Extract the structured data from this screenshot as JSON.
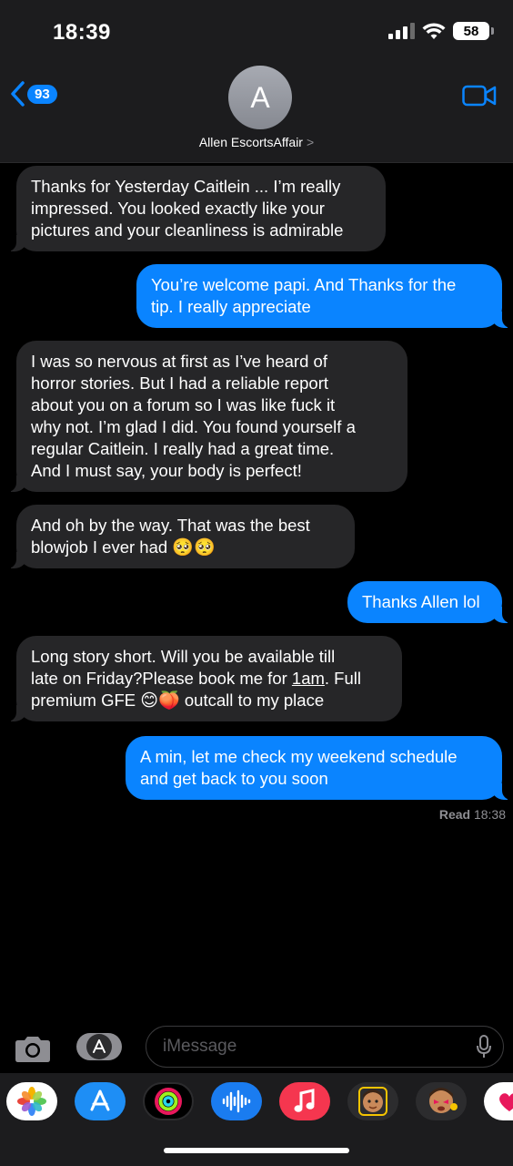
{
  "status_bar": {
    "time": "18:39",
    "battery": "58"
  },
  "nav": {
    "back_count": "93",
    "avatar_initial": "A",
    "contact_name": "Allen EscortsAffair",
    "contact_chevron": ">"
  },
  "messages": [
    {
      "direction": "incoming",
      "text": "Thanks for Yesterday Caitlein ... I’m really\nimpressed. You looked exactly like your\npictures and your cleanliness is admirable"
    },
    {
      "direction": "outgoing",
      "text": "You’re welcome papi. And Thanks for the\ntip. I really appreciate"
    },
    {
      "direction": "incoming",
      "text": "I was so nervous at first as I’ve heard of\nhorror stories. But I had a reliable report\nabout you on a forum so I was like fuck it\nwhy not. I’m glad I did.  You found yourself a\nregular Caitlein. I really had a great time.\nAnd I must say, your body is perfect!"
    },
    {
      "direction": "incoming",
      "text_a": "And oh by the way. That was the best\nblowjob I ever had ",
      "emoji": "🥺🥺"
    },
    {
      "direction": "outgoing",
      "text": "Thanks Allen lol"
    },
    {
      "direction": "incoming",
      "text_a": "Long story short. Will you be available till\nlate on Friday?Please book me for ",
      "link": "1am",
      "text_b": ". Full\npremium GFE ",
      "emoji": "😊🍑",
      "text_c": " outcall to my place"
    },
    {
      "direction": "outgoing",
      "text": "A min, let me check my weekend schedule\nand get back to you soon"
    }
  ],
  "read_receipt": {
    "label": "Read",
    "time": "18:38"
  },
  "composer": {
    "placeholder": "iMessage"
  },
  "app_drawer": {
    "apps": [
      "photos-icon",
      "app-store-icon",
      "activity-icon",
      "audio-message-icon",
      "music-icon",
      "memoji-icon",
      "memoji-stickers-icon",
      "digital-touch-icon"
    ]
  },
  "colors": {
    "incoming_bubble": "#262628",
    "outgoing_bubble": "#0a84ff",
    "background": "#000000",
    "header": "#1c1c1e"
  }
}
